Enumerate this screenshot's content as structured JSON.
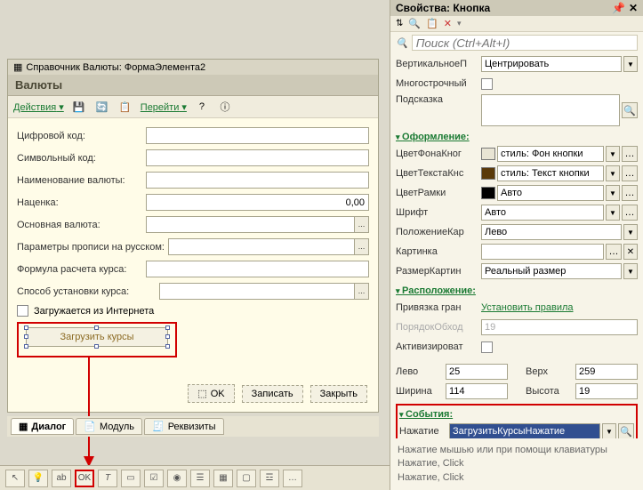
{
  "right": {
    "title": "Свойства: Кнопка",
    "search_placeholder": "Поиск (Ctrl+Alt+I)",
    "rows": {
      "valign": {
        "label": "ВертикальноеП",
        "value": "Центрировать"
      },
      "multiline": {
        "label": "Многострочный"
      },
      "tooltip": {
        "label": "Подсказка",
        "value": ""
      }
    },
    "sect_design": "Оформление:",
    "design": {
      "bgcolor": {
        "label": "ЦветФонаКног",
        "value": "стиль: Фон кнопки"
      },
      "textcolor": {
        "label": "ЦветТекстаКнс",
        "value": "стиль: Текст кнопки"
      },
      "border": {
        "label": "ЦветРамки",
        "value": "Авто"
      },
      "font": {
        "label": "Шрифт",
        "value": "Авто"
      },
      "caretpos": {
        "label": "ПоложениеКар",
        "value": "Лево"
      },
      "picture": {
        "label": "Картинка",
        "value": ""
      },
      "picsize": {
        "label": "РазмерКартин",
        "value": "Реальный размер"
      }
    },
    "sect_layout": "Расположение:",
    "layout": {
      "anchor": {
        "label": "Привязка гран",
        "value": "Установить правила"
      },
      "taborder": {
        "label": "ПорядокОбход",
        "value": "19"
      },
      "activate": {
        "label": "Активизироват"
      },
      "left_l": "Лево",
      "left_v": "25",
      "top_l": "Верх",
      "top_v": "259",
      "width_l": "Ширина",
      "width_v": "114",
      "height_l": "Высота",
      "height_v": "19"
    },
    "sect_events": "События:",
    "event": {
      "label": "Нажатие",
      "value": "ЗагрузитьКурсыНажатие"
    },
    "hint1": "Нажатие мышью или при помощи клавиатуры",
    "hint2": "Нажатие, Click",
    "hint3": "Нажатие, Click"
  },
  "left": {
    "win_title": "Справочник Валюты: ФормаЭлемента2",
    "form_title": "Валюты",
    "actions": "Действия",
    "goto": "Перейти",
    "fields": {
      "numcode": "Цифровой код:",
      "symcode": "Символьный код:",
      "name": "Наименование валюты:",
      "markup": "Наценка:",
      "markup_val": "0,00",
      "basecur": "Основная валюта:",
      "params": "Параметры прописи на русском:",
      "formula": "Формула расчета курса:",
      "method": "Способ установки курса:",
      "internet": "Загружается из Интернета"
    },
    "button_label": "Загрузить курсы",
    "ok": "OK",
    "save": "Записать",
    "close": "Закрыть",
    "tabs": {
      "dialog": "Диалог",
      "module": "Модуль",
      "req": "Реквизиты"
    }
  }
}
